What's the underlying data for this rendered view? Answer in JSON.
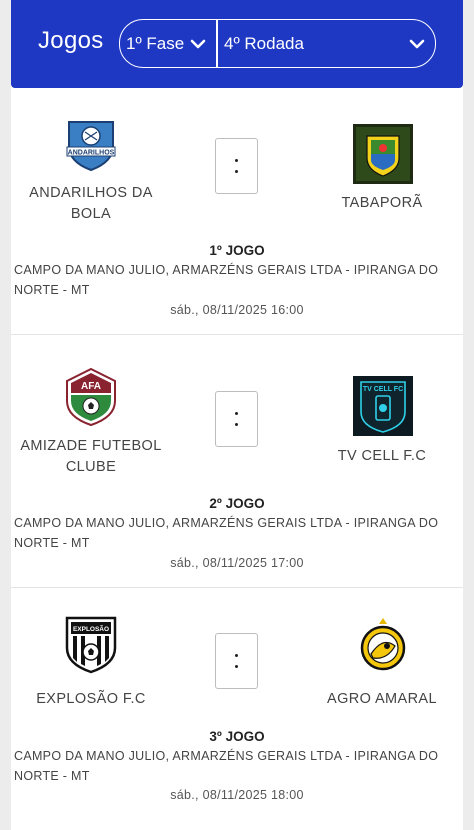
{
  "header": {
    "title": "Jogos",
    "phase_select": "1º Fase",
    "round_select": "4º Rodada"
  },
  "matches": [
    {
      "home": "ANDARILHOS DA BOLA",
      "away": "TABAPORÃ",
      "home_logo_text": "ANDARILHOS",
      "away_logo_text": "",
      "score_home": "",
      "score_away": "",
      "game": "1º JOGO",
      "venue": "CAMPO DA MANO JULIO, ARMARZÉNS GERAIS LTDA - IPIRANGA DO NORTE - MT",
      "datetime": "sáb., 08/11/2025 16:00"
    },
    {
      "home": "AMIZADE FUTEBOL CLUBE",
      "away": "TV CELL F.C",
      "home_logo_text": "AFA",
      "away_logo_text": "TV CELL FC",
      "score_home": "",
      "score_away": "",
      "game": "2º JOGO",
      "venue": "CAMPO DA MANO JULIO, ARMARZÉNS GERAIS LTDA - IPIRANGA DO NORTE - MT",
      "datetime": "sáb., 08/11/2025 17:00"
    },
    {
      "home": "EXPLOSÃO F.C",
      "away": "AGRO AMARAL",
      "home_logo_text": "EXPLOSÃO",
      "away_logo_text": "",
      "score_home": "",
      "score_away": "",
      "game": "3º JOGO",
      "venue": "CAMPO DA MANO JULIO, ARMARZÉNS GERAIS LTDA - IPIRANGA DO NORTE - MT",
      "datetime": "sáb., 08/11/2025 18:00"
    }
  ],
  "colors": {
    "header_bg": "#1f38c4",
    "header_text": "#ffffff",
    "page_bg": "#ffffff"
  }
}
